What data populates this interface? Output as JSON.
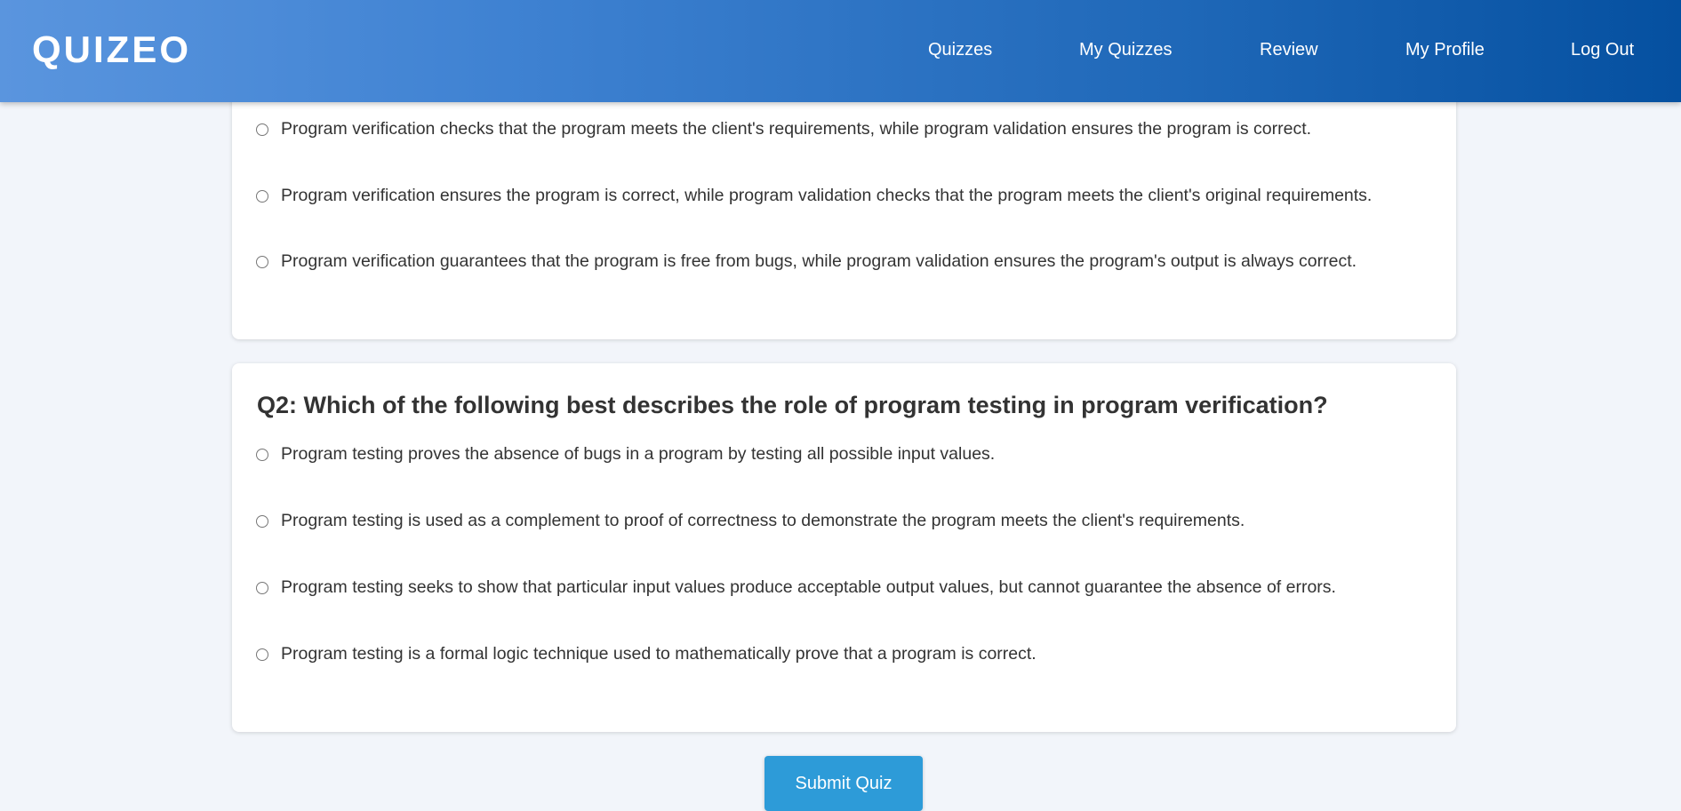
{
  "header": {
    "logo": "QUIZEO",
    "nav": [
      "Quizzes",
      "My Quizzes",
      "Review",
      "My Profile",
      "Log Out"
    ]
  },
  "questions": [
    {
      "title": "",
      "options": [
        "Program verification checks that the program meets the client's requirements, while program validation ensures the program is correct.",
        "Program verification ensures the program is correct, while program validation checks that the program meets the client's original requirements.",
        "Program verification guarantees that the program is free from bugs, while program validation ensures the program's output is always correct."
      ]
    },
    {
      "title": "Q2: Which of the following best describes the role of program testing in program verification?",
      "options": [
        "Program testing proves the absence of bugs in a program by testing all possible input values.",
        "Program testing is used as a complement to proof of correctness to demonstrate the program meets the client's requirements.",
        "Program testing seeks to show that particular input values produce acceptable output values, but cannot guarantee the absence of errors.",
        "Program testing is a formal logic technique used to mathematically prove that a program is correct."
      ]
    }
  ],
  "submit_label": "Submit Quiz",
  "colors": {
    "header_gradient_start": "#5a95de",
    "header_gradient_end": "#0550a0",
    "submit_button": "#2d9bd8",
    "page_background": "#f2f5fa"
  }
}
